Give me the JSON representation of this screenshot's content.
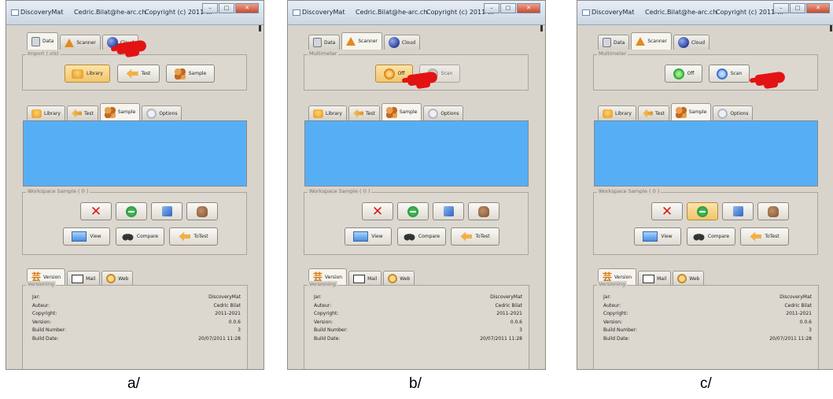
{
  "window": {
    "app_title": "DiscoveryMat",
    "user": "Cedric.Bilat@he-arc.ch",
    "copyright": "Copyright (c) 2011-..."
  },
  "top_tabs": [
    "Data",
    "Scanner",
    "Cloud"
  ],
  "import_group": {
    "title": "Import (.xls)",
    "buttons": [
      "Library",
      "Test",
      "Sample"
    ]
  },
  "multimeter": {
    "title": "Multimeter",
    "off_label": "Off",
    "scan_label": "Scan"
  },
  "mid_tabs": [
    "Library",
    "Test",
    "Sample",
    "Options"
  ],
  "workspace": {
    "title": "Workspace Sample ( 0 )",
    "view_label": "View",
    "compare_label": "Compare",
    "totest_label": "ToTest"
  },
  "bottom_tabs": [
    "Version",
    "Mail",
    "Web"
  ],
  "versioning": {
    "title": "Versioning",
    "rows": [
      {
        "key": "Jar:",
        "value": "DiscoveryMat"
      },
      {
        "key": "Auteur:",
        "value": "Cedric Bilat"
      },
      {
        "key": "Copyright:",
        "value": "2011-2021"
      },
      {
        "key": "Version:",
        "value": "0.0.6"
      },
      {
        "key": "Build Number:",
        "value": "3"
      },
      {
        "key": "Build Date:",
        "value": "20/07/2011 11:28"
      }
    ]
  },
  "captions": [
    "a/",
    "b/",
    "c/"
  ]
}
